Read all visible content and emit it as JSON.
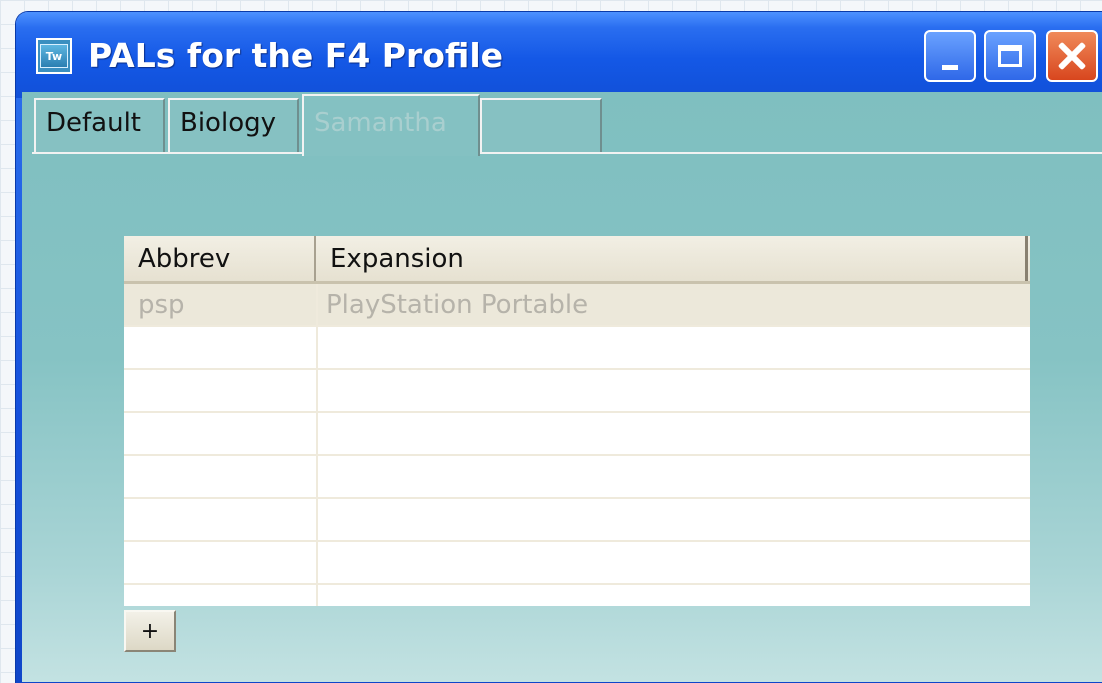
{
  "window": {
    "title": "PALs for the F4 Profile",
    "app_icon_text": "Tw",
    "controls": [
      "minimize",
      "maximize",
      "close"
    ]
  },
  "tabs": [
    {
      "label": "Default",
      "state": "normal"
    },
    {
      "label": "Biology",
      "state": "normal"
    },
    {
      "label": "Samantha",
      "state": "selected-disabled"
    },
    {
      "label": "",
      "state": "normal"
    }
  ],
  "table": {
    "columns": [
      "Abbrev",
      "Expansion"
    ],
    "rows": [
      {
        "abbrev": "psp",
        "expansion": "PlayStation Portable"
      },
      {
        "abbrev": "",
        "expansion": ""
      },
      {
        "abbrev": "",
        "expansion": ""
      },
      {
        "abbrev": "",
        "expansion": ""
      },
      {
        "abbrev": "",
        "expansion": ""
      },
      {
        "abbrev": "",
        "expansion": ""
      },
      {
        "abbrev": "",
        "expansion": ""
      },
      {
        "abbrev": "",
        "expansion": ""
      }
    ]
  },
  "add_button": {
    "label": "+"
  },
  "colors": {
    "titlebar_blue": "#1458e6",
    "client_teal": "#86c3c4",
    "close_red": "#d8461e",
    "grid_header": "#e6e1d1"
  }
}
